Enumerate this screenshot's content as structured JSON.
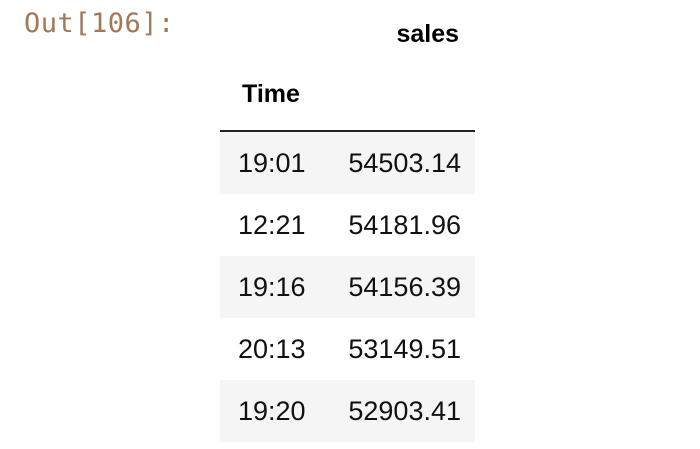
{
  "output_prompt": "Out[106]:",
  "dataframe": {
    "column_label": "sales",
    "index_name": "Time",
    "rows": [
      {
        "index": "19:01",
        "sales": "54503.14"
      },
      {
        "index": "12:21",
        "sales": "54181.96"
      },
      {
        "index": "19:16",
        "sales": "54156.39"
      },
      {
        "index": "20:13",
        "sales": "53149.51"
      },
      {
        "index": "19:20",
        "sales": "52903.41"
      }
    ]
  }
}
